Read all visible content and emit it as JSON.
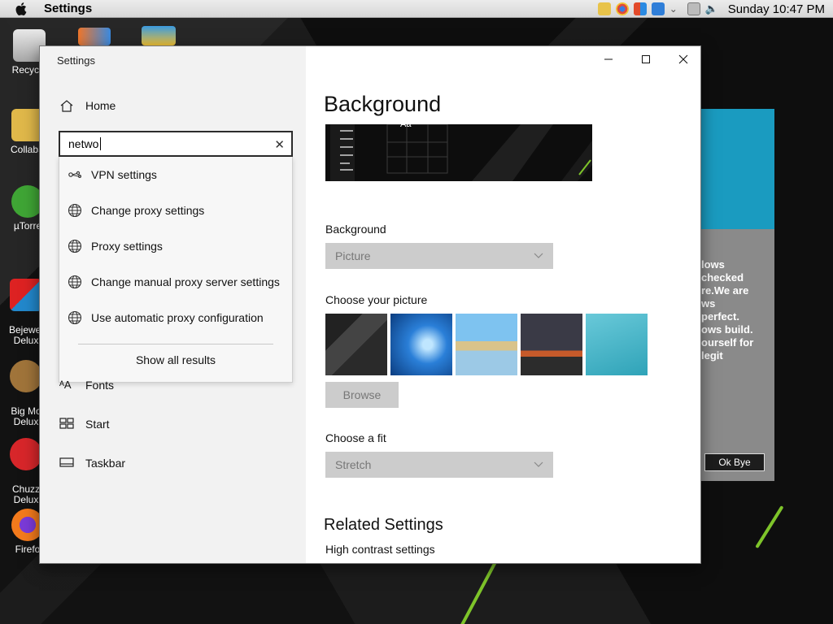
{
  "menubar": {
    "app_name": "Settings",
    "clock": "Sunday 10:47 PM",
    "tray_icons": [
      "finder-icon",
      "chrome-icon",
      "office-icon",
      "gear-icon",
      "chevron-down-icon",
      "network-icon",
      "volume-icon"
    ]
  },
  "desktop_icons": [
    {
      "name": "recycle-bin",
      "label": "Recycle"
    },
    {
      "name": "collabs",
      "label": "CollabS"
    },
    {
      "name": "utorrent",
      "label": "µTorre"
    },
    {
      "name": "bejeweled",
      "label": "Bejewel\nDelux"
    },
    {
      "name": "big-money",
      "label": "Big Mo\nDelux"
    },
    {
      "name": "chuzzle",
      "label": "Chuzz\nDelux"
    },
    {
      "name": "firefox",
      "label": "Firefo"
    }
  ],
  "background_popup": {
    "message": "lows\nchecked\nre.We are\nws\nperfect.\nows build.\nourself for\nlegit",
    "ok_button": "Ok Bye"
  },
  "settings": {
    "window_title": "Settings",
    "nav": {
      "home": "Home",
      "fonts": "Fonts",
      "start": "Start",
      "taskbar": "Taskbar"
    },
    "search": {
      "value": "netwo",
      "suggestions": [
        "VPN settings",
        "Change proxy settings",
        "Proxy settings",
        "Change manual proxy server settings",
        "Use automatic proxy configuration"
      ],
      "show_all": "Show all results"
    },
    "main": {
      "heading": "Background",
      "preview_text": "Aa",
      "background_label": "Background",
      "background_value": "Picture",
      "choose_picture_label": "Choose your picture",
      "browse_label": "Browse",
      "fit_label": "Choose a fit",
      "fit_value": "Stretch",
      "related_heading": "Related Settings",
      "related_link": "High contrast settings"
    }
  },
  "colors": {
    "sidebar_bg": "#f2f2f2",
    "disabled_control": "#cccccc",
    "wallpaper_accent": "#7ec42a"
  }
}
